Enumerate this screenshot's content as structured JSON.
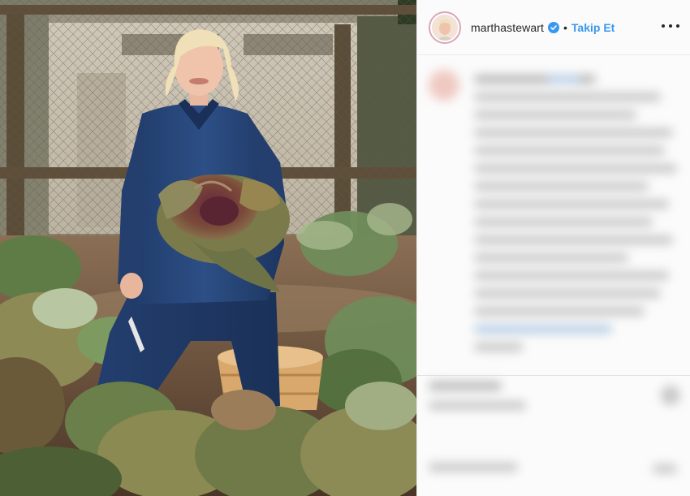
{
  "post": {
    "username": "marthastewart",
    "separator": "•",
    "follow_label": "Takip Et",
    "verified_icon": "verified-badge-icon",
    "more_icon": "more-options-icon"
  },
  "colors": {
    "follow": "#3897f0",
    "verified": "#3897f0",
    "avatar_ring": "#d9a7b7"
  }
}
